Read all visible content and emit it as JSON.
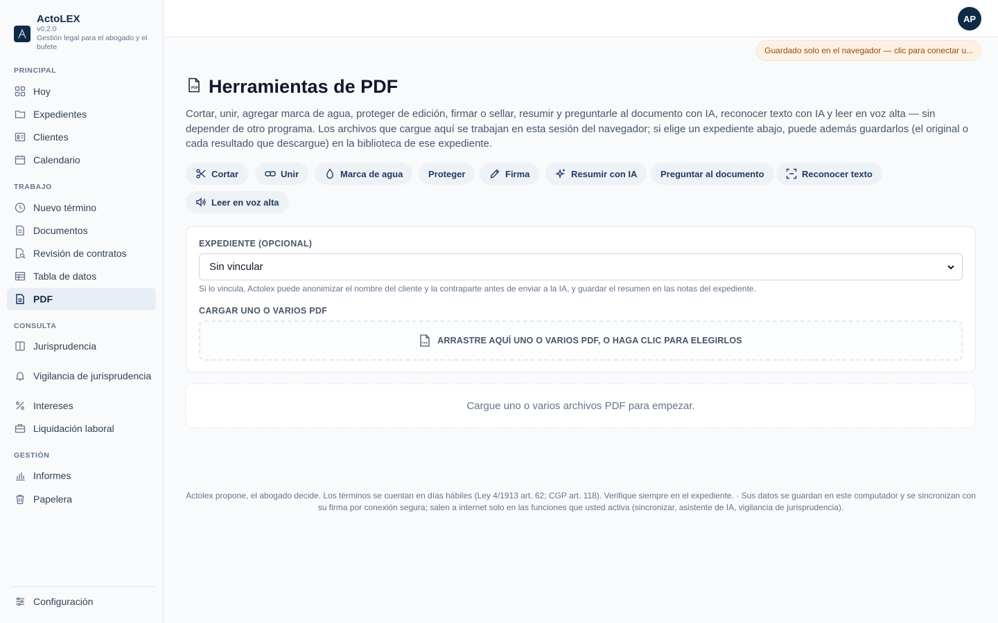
{
  "brand": {
    "name": "ActoLEX",
    "version": "v0.2.0",
    "tagline": "Gestión legal para el abogado y el bufete"
  },
  "sidebar": {
    "sections": {
      "principal": "PRINCIPAL",
      "trabajo": "TRABAJO",
      "consulta": "CONSULTA",
      "gestion": "GESTIÓN"
    },
    "items": {
      "hoy": "Hoy",
      "expedientes": "Expedientes",
      "clientes": "Clientes",
      "calendario": "Calendario",
      "nuevo_termino": "Nuevo término",
      "documentos": "Documentos",
      "revision": "Revisión de contratos",
      "tabla": "Tabla de datos",
      "pdf": "PDF",
      "jurisprudencia": "Jurisprudencia",
      "vigilancia": "Vigilancia de jurisprudencia",
      "intereses": "Intereses",
      "liquidacion": "Liquidación laboral",
      "informes": "Informes",
      "papelera": "Papelera",
      "configuracion": "Configuración"
    },
    "active": "pdf"
  },
  "topbar": {
    "avatar_initials": "AP"
  },
  "save_status": "Guardado solo en el navegador — clic para conectar u...",
  "page": {
    "title": "Herramientas de PDF",
    "description": "Cortar, unir, agregar marca de agua, proteger de edición, firmar o sellar, resumir y preguntarle al documento con IA, reconocer texto con IA y leer en voz alta — sin depender de otro programa. Los archivos que cargue aquí se trabajan en esta sesión del navegador; si elige un expediente abajo, puede además guardarlos (el original o cada resultado que descargue) en la biblioteca de ese expediente."
  },
  "tools": {
    "cortar": "Cortar",
    "unir": "Unir",
    "marca": "Marca de agua",
    "proteger": "Proteger",
    "firma": "Firma",
    "resumir": "Resumir con IA",
    "preguntar": "Preguntar al documento",
    "reconocer": "Reconocer texto",
    "leer": "Leer en voz alta"
  },
  "form": {
    "expediente_label": "EXPEDIENTE (OPCIONAL)",
    "expediente_value": "Sin vincular",
    "hint": "Si lo vincula, Actolex puede anonimizar el nombre del cliente y la contraparte antes de enviar a la IA, y guardar el resumen en las notas del expediente.",
    "upload_label": "CARGAR UNO O VARIOS PDF",
    "dropzone_text": "ARRASTRE AQUÍ UNO O VARIOS PDF, O HAGA CLIC PARA ELEGIRLOS"
  },
  "empty_state": "Cargue uno o varios archivos PDF para empezar.",
  "footer": {
    "line1": "Actolex propone, el abogado decide. Los términos se cuentan en días hábiles (Ley 4/1913 art. 62; CGP art. 118). Verifique siempre en el expediente. · Sus datos se guardan en este computador y se sincronizan con",
    "line2": "su firma por conexión segura; salen a internet solo en las funciones que usted activa (sincronizar, asistente de IA, vigilancia de jurisprudencia)."
  }
}
